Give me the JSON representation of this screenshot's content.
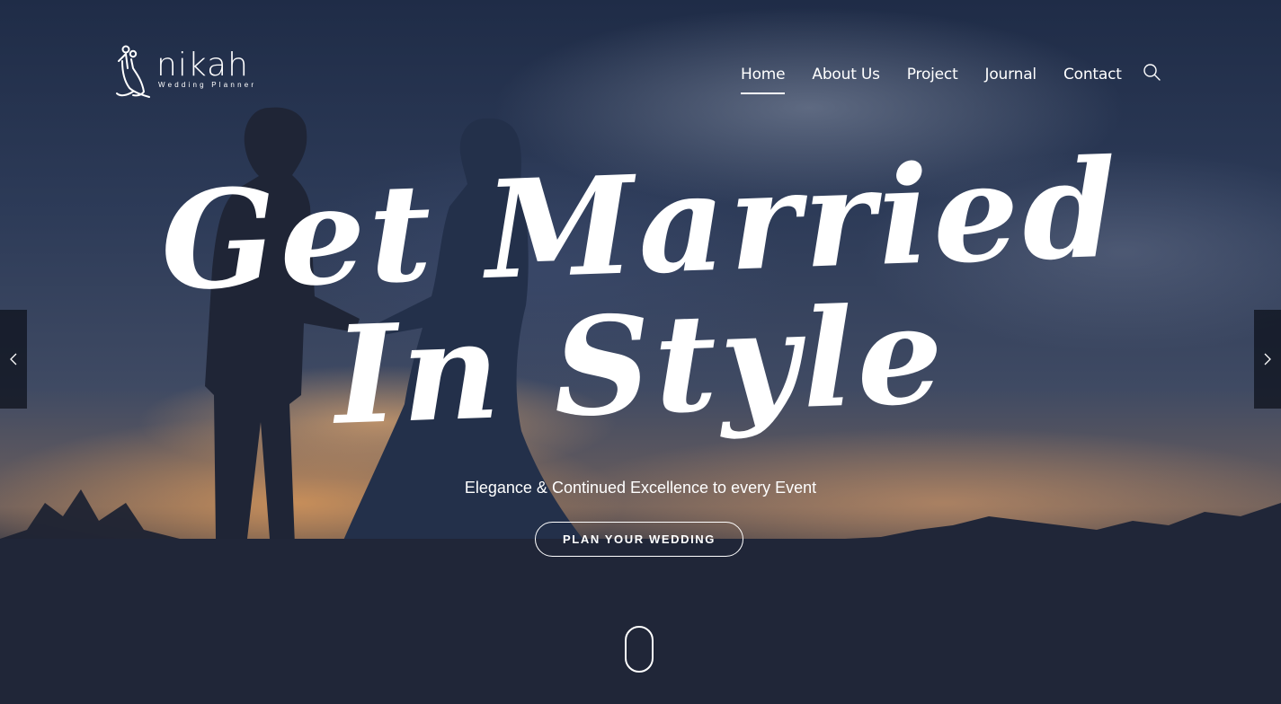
{
  "brand": {
    "name": "nikah",
    "tagline": "Wedding Planner",
    "logo_icon": "couple-outline-icon"
  },
  "nav": {
    "items": [
      {
        "label": "Home",
        "active": true
      },
      {
        "label": "About Us",
        "active": false
      },
      {
        "label": "Project",
        "active": false
      },
      {
        "label": "Journal",
        "active": false
      },
      {
        "label": "Contact",
        "active": false
      }
    ],
    "search_icon": "search-icon"
  },
  "hero": {
    "headline_line1": "Get Married",
    "headline_line2": "In Style",
    "subtitle": "Elegance & Continued Excellence to every Event",
    "cta_label": "PLAN YOUR WEDDING",
    "prev_icon": "chevron-left-icon",
    "next_icon": "chevron-right-icon",
    "scroll_indicator": "mouse-scroll-icon"
  },
  "colors": {
    "text": "#ffffff",
    "ground": "#202638",
    "slider_arrow_bg": "#0e111c"
  }
}
